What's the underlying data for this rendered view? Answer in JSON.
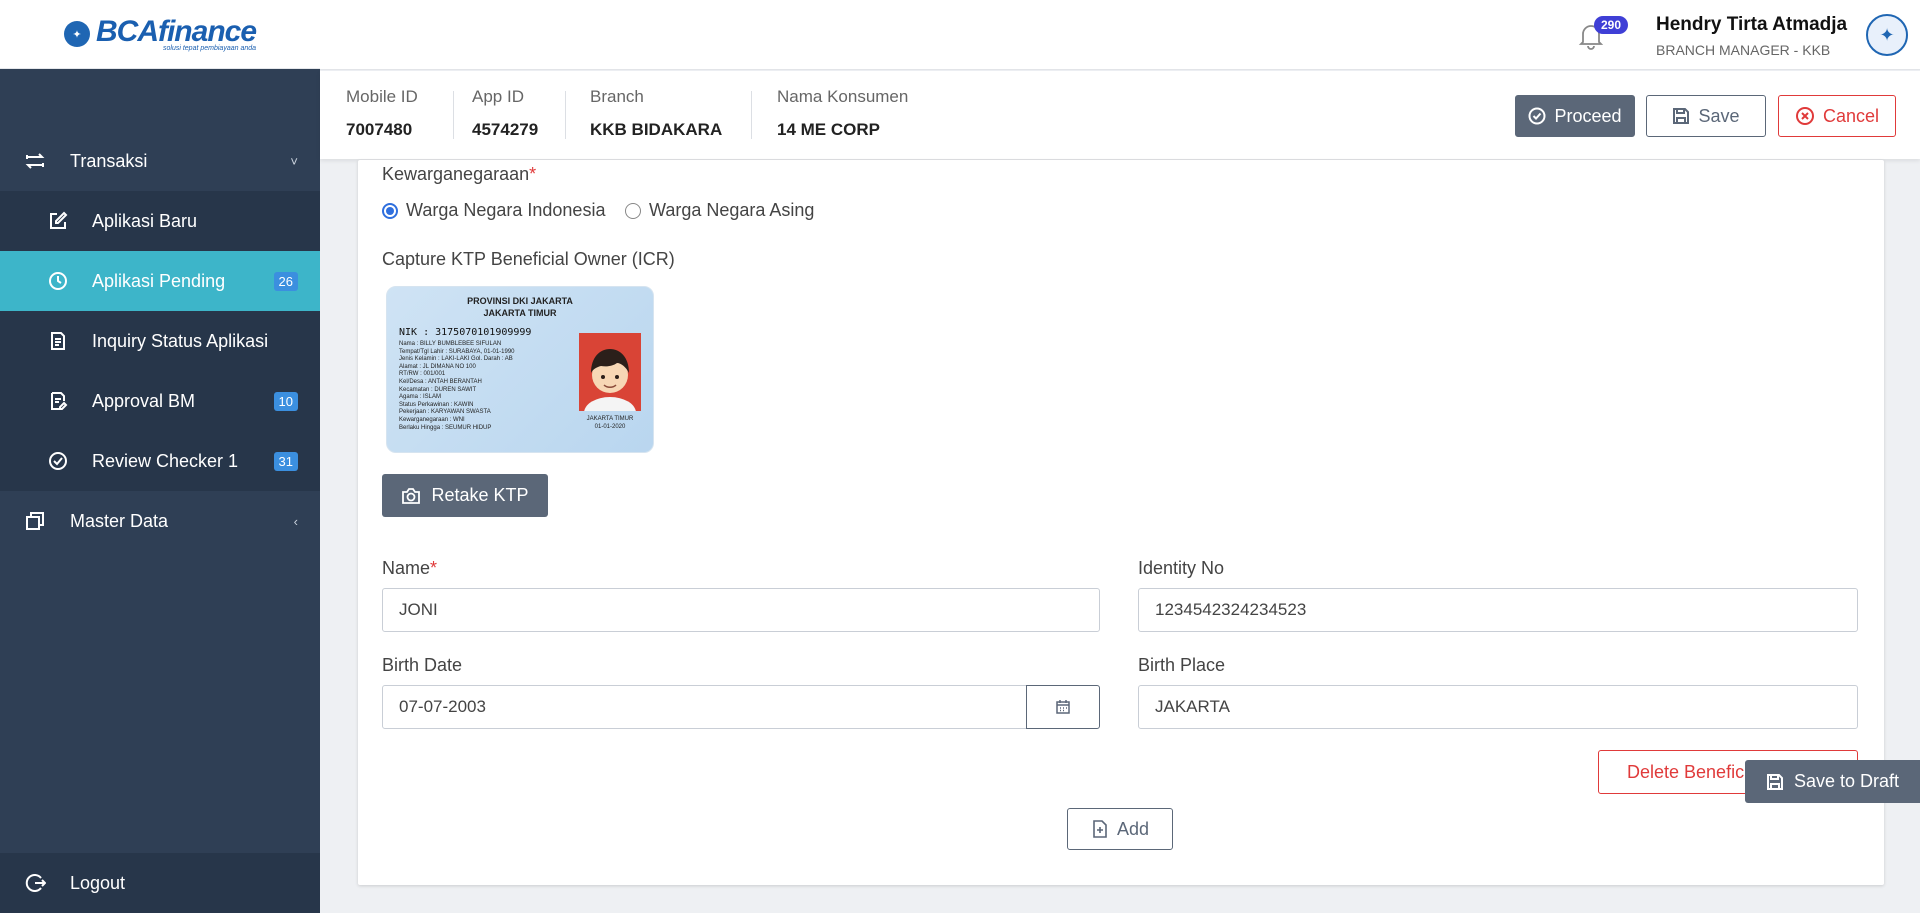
{
  "brand": {
    "logo_text": "BCAfinance",
    "tagline": "solusi tepat pembiayaan anda"
  },
  "sidebar": {
    "groups": [
      {
        "label": "Transaksi",
        "icon": "arrows-exchange-icon",
        "chevron": "˅"
      },
      {
        "label": "Master Data",
        "icon": "copy-stack-icon",
        "chevron": "‹"
      }
    ],
    "items": [
      {
        "label": "Aplikasi Baru",
        "icon": "edit-square-icon"
      },
      {
        "label": "Aplikasi Pending",
        "icon": "clock-icon",
        "badge": "26",
        "active": true
      },
      {
        "label": "Inquiry Status Aplikasi",
        "icon": "document-list-icon"
      },
      {
        "label": "Approval BM",
        "icon": "document-edit-icon",
        "badge": "10"
      },
      {
        "label": "Review Checker 1",
        "icon": "check-circle-icon",
        "badge": "31"
      }
    ],
    "logout_label": "Logout"
  },
  "header": {
    "notification_count": "290",
    "user_name": "Hendry Tirta Atmadja",
    "user_role": "BRANCH MANAGER - KKB"
  },
  "info": {
    "mobile_id_label": "Mobile ID",
    "mobile_id": "7007480",
    "app_id_label": "App ID",
    "app_id": "4574279",
    "branch_label": "Branch",
    "branch": "KKB BIDAKARA",
    "consumer_label": "Nama Konsumen",
    "consumer": "14 ME CORP"
  },
  "actions": {
    "proceed": "Proceed",
    "save": "Save",
    "cancel": "Cancel"
  },
  "form": {
    "citizenship_label": "Kewarganegaraan",
    "citizenship_options": [
      "Warga Negara Indonesia",
      "Warga Negara Asing"
    ],
    "citizenship_selected": "Warga Negara Indonesia",
    "capture_label": "Capture KTP Beneficial Owner (ICR)",
    "ktp": {
      "province": "PROVINSI DKI JAKARTA",
      "city": "JAKARTA TIMUR",
      "nik": "NIK    : 3175070101909999",
      "rows": [
        "Nama              : BILLY BUMBLEBEE SIFULAN",
        "Tempat/Tgl Lahir : SURABAYA, 01-01-1990",
        "Jenis Kelamin     : LAKI-LAKI      Gol. Darah : AB",
        "Alamat             : JL DIMANA NO 100",
        "      RT/RW          : 001/001",
        "      Kel/Desa       : ANTAH BERANTAH",
        "      Kecamatan      : DUREN SAWIT",
        "Agama             : ISLAM",
        "Status Perkawinan : KAWIN",
        "Pekerjaan          : KARYAWAN SWASTA",
        "Kewarganegaraan  : WNI",
        "Berlaku Hingga    : SEUMUR HIDUP"
      ],
      "issue_place": "JAKARTA TIMUR",
      "issue_date": "01-01-2020"
    },
    "retake_label": "Retake KTP",
    "name_label": "Name",
    "name_value": "JONI",
    "identity_label": "Identity No",
    "identity_value": "1234542324234523",
    "birth_date_label": "Birth Date",
    "birth_date_value": "07-07-2003",
    "birth_place_label": "Birth Place",
    "birth_place_value": "JAKARTA",
    "delete_label": "Delete Beneficial Owner",
    "add_label": "Add"
  },
  "draft_label": "Save to Draft",
  "colors": {
    "sidebar": "#2f3f55",
    "active": "#3db5c9",
    "primary_btn": "#5b6778",
    "danger": "#e03a3a",
    "radio": "#2f6fde"
  }
}
